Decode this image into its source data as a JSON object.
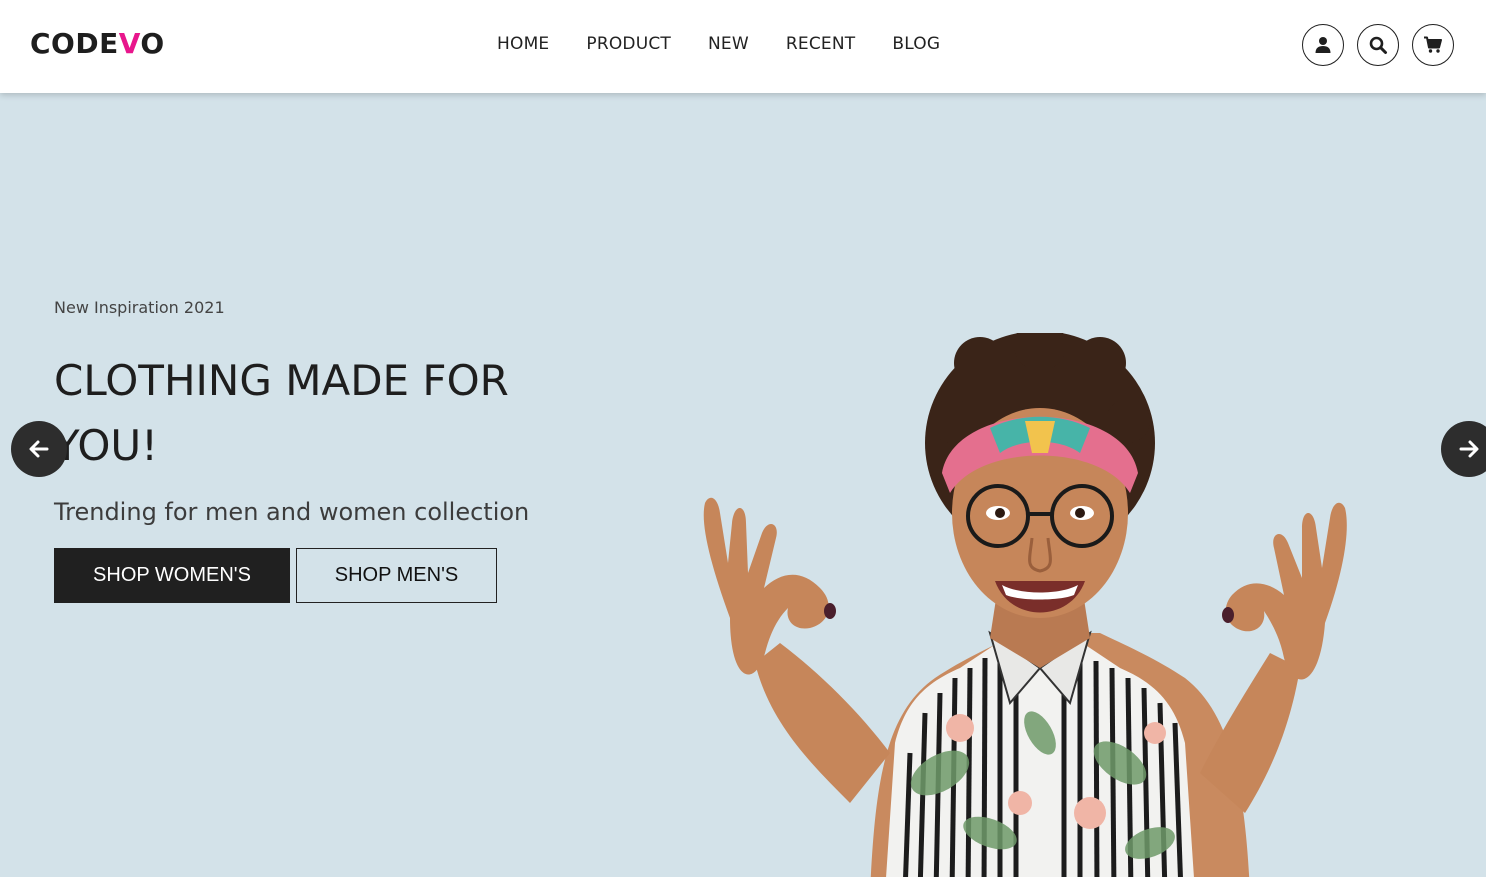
{
  "brand": {
    "prefix": "CODE",
    "accent": "V",
    "suffix": "O",
    "accent_color": "#e8168c"
  },
  "nav": {
    "items": [
      {
        "label": "HOME"
      },
      {
        "label": "PRODUCT"
      },
      {
        "label": "NEW"
      },
      {
        "label": "RECENT"
      },
      {
        "label": "BLOG"
      }
    ]
  },
  "header_icons": [
    "user-icon",
    "search-icon",
    "cart-icon"
  ],
  "hero": {
    "eyebrow": "New Inspiration 2021",
    "headline": "CLOTHING MADE FOR YOU!",
    "subline": "Trending for men and women collection",
    "primary_button": "SHOP WOMEN'S",
    "secondary_button": "SHOP MEN'S",
    "background_color": "#d3e2e9"
  },
  "slider": {
    "prev_icon": "arrow-left-icon",
    "next_icon": "arrow-right-icon"
  }
}
